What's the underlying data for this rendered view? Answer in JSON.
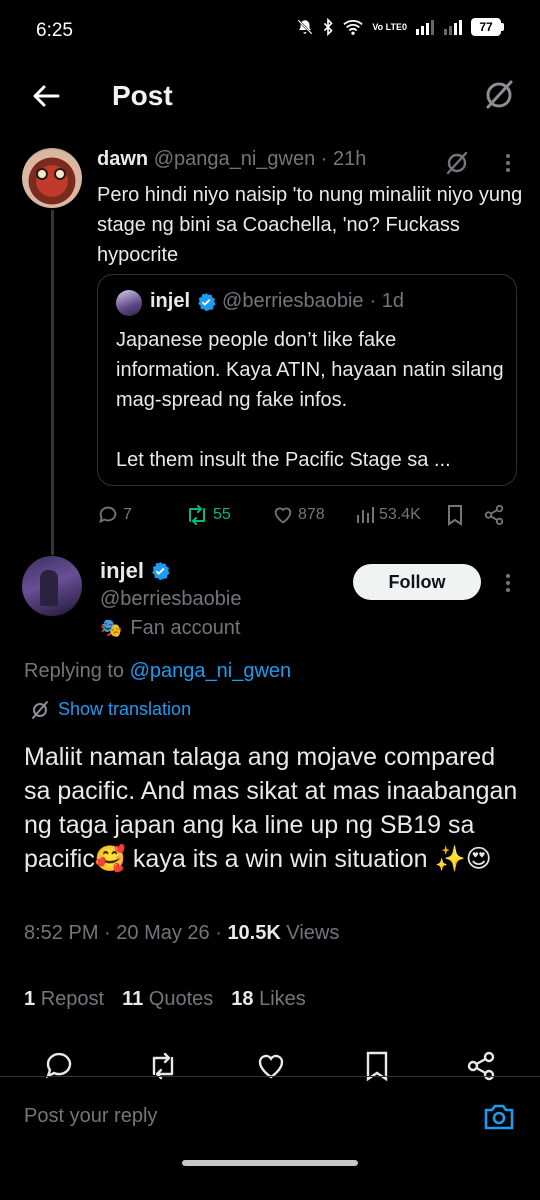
{
  "status_bar": {
    "time": "6:25",
    "network": "Vo LTE0",
    "battery": "77"
  },
  "header": {
    "title": "Post"
  },
  "reply_tweet": {
    "name": "dawn",
    "handle": "@panga_ni_gwen",
    "time": "· 21h",
    "text": "Pero hindi niyo naisip 'to nung minaliit niyo yung stage ng bini sa Coachella, 'no? Fuckass hypocrite",
    "quote": {
      "name": "injel",
      "handle": "@berriesbaobie",
      "time": "· 1d",
      "paragraph1": "Japanese people don’t like fake information. Kaya ATIN, hayaan natin silang mag-spread ng fake infos.",
      "paragraph2": "Let them insult the Pacific Stage sa ..."
    },
    "actions": {
      "replies": "7",
      "reposts": "55",
      "likes": "878",
      "views": "53.4K"
    }
  },
  "main_tweet": {
    "name": "injel",
    "handle": "@berriesbaobie",
    "fan_label": "Fan account",
    "follow_label": "Follow",
    "replying_prefix": "Replying to ",
    "replying_handle": "@panga_ni_gwen",
    "show_translation": "Show translation",
    "text": "Maliit naman talaga ang mojave compared sa pacific. And mas sikat at mas inaabangan ng taga japan ang ka line up ng SB19 sa pacific🥰 kaya its a win win situation ✨😍",
    "meta": {
      "time": "8:52 PM",
      "date": "20 May 26",
      "views_count": "10.5K",
      "views_label": "Views"
    },
    "stats": {
      "reposts_count": "1",
      "reposts_label": "Repost",
      "quotes_count": "11",
      "quotes_label": "Quotes",
      "likes_count": "18",
      "likes_label": "Likes"
    }
  },
  "reply_bar": {
    "placeholder": "Post your reply"
  },
  "colors": {
    "background": "#000000",
    "text": "#e7e9ea",
    "secondary": "#71767b",
    "link": "#1d9bf0",
    "repost_green": "#00ba7c",
    "border": "#2f3336"
  },
  "icons": [
    "back-arrow-icon",
    "grok-icon",
    "more-icon",
    "reply-icon",
    "repost-icon",
    "like-icon",
    "views-icon",
    "bookmark-icon",
    "share-icon",
    "verified-badge-icon",
    "theater-mask-icon",
    "translate-icon",
    "camera-icon"
  ]
}
